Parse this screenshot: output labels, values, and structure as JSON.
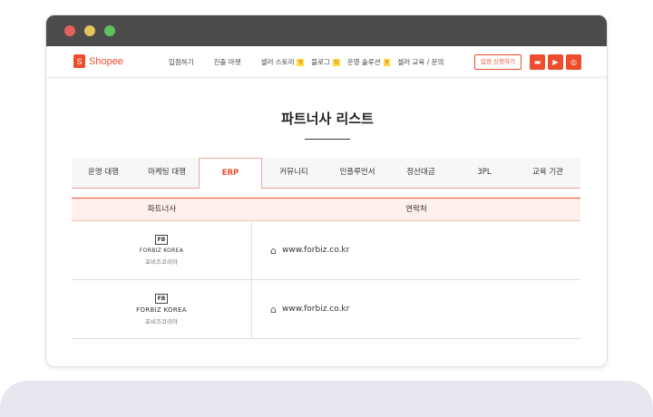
{
  "colors": {
    "accent": "#ee4d2d",
    "close": "#e5615e",
    "minimize": "#e4c55a",
    "maximize": "#5fc25c"
  },
  "nav": {
    "logo": "Shopee",
    "items": [
      {
        "label": "입점하기"
      },
      {
        "label": "진출 마켓"
      },
      {
        "label": "셀러 스토리",
        "badge": "N"
      },
      {
        "label": "블로그",
        "badge": "N"
      },
      {
        "label": "운영 솔루션",
        "badge": "N"
      },
      {
        "label": "셀러 교육 / 문의"
      }
    ],
    "apply_button": "입점 신청하기",
    "social": [
      "chat-icon",
      "youtube-icon",
      "instagram-icon"
    ]
  },
  "page": {
    "title": "파트너사 리스트"
  },
  "tabs": [
    {
      "label": "운영 대행"
    },
    {
      "label": "마케팅 대행"
    },
    {
      "label": "ERP",
      "active": true
    },
    {
      "label": "커뮤니티"
    },
    {
      "label": "인플루언서"
    },
    {
      "label": "정산대금"
    },
    {
      "label": "3PL"
    },
    {
      "label": "교육 기관"
    }
  ],
  "table": {
    "headers": [
      "파트너사",
      "연락처"
    ],
    "rows": [
      {
        "logo_mark": "FB",
        "name_en": "FORBIZ KOREA",
        "name_ko": "포비즈코리아",
        "url": "www.forbiz.co.kr"
      },
      {
        "logo_mark": "FB",
        "name_en": "FORBIZ KOREA",
        "name_ko": "포비즈코리아",
        "url": "www.forbiz.co.kr"
      }
    ]
  }
}
